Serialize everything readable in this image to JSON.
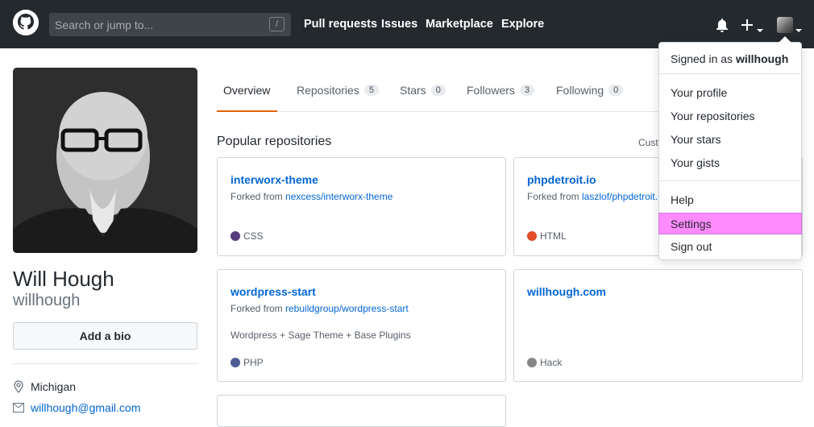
{
  "header": {
    "search_placeholder": "Search or jump to...",
    "search_shortcut": "/",
    "nav": [
      "Pull requests",
      "Issues",
      "Marketplace",
      "Explore"
    ],
    "icons": [
      "github-logo-icon",
      "bell-icon",
      "plus-icon",
      "avatar-icon"
    ]
  },
  "profile": {
    "fullname": "Will Hough",
    "login": "willhough",
    "bio_button": "Add a bio",
    "location": "Michigan",
    "email": "willhough@gmail.com"
  },
  "tabs": [
    {
      "label": "Overview",
      "count": ""
    },
    {
      "label": "Repositories",
      "count": "5"
    },
    {
      "label": "Stars",
      "count": "0"
    },
    {
      "label": "Followers",
      "count": "3"
    },
    {
      "label": "Following",
      "count": "0"
    }
  ],
  "section": {
    "title": "Popular repositories",
    "customize": "Cust"
  },
  "repos": [
    {
      "name": "interworx-theme",
      "fork_prefix": "Forked from ",
      "fork_source": "nexcess/interworx-theme",
      "desc": "",
      "lang": "CSS",
      "lang_color": "#563d7c"
    },
    {
      "name": "phpdetroit.io",
      "fork_prefix": "Forked from ",
      "fork_source": "laszlof/phpdetroit.io",
      "desc": "",
      "lang": "HTML",
      "lang_color": "#e34c26"
    },
    {
      "name": "wordpress-start",
      "fork_prefix": "Forked from ",
      "fork_source": "rebuildgroup/wordpress-start",
      "desc": "Wordpress + Sage Theme + Base Plugins",
      "lang": "PHP",
      "lang_color": "#4F5D95"
    },
    {
      "name": "willhough.com",
      "fork_prefix": "",
      "fork_source": "",
      "desc": "",
      "lang": "Hack",
      "lang_color": "#878787"
    }
  ],
  "dropdown": {
    "signed_prefix": "Signed in as ",
    "signed_user": "willhough",
    "items": [
      "Your profile",
      "Your repositories",
      "Your stars",
      "Your gists",
      "Help",
      "Settings",
      "Sign out"
    ]
  },
  "colors": {
    "header_bg": "#24292e",
    "link": "#0366d6",
    "active_tab": "#e36209",
    "settings_highlight": "#ff8bff"
  }
}
